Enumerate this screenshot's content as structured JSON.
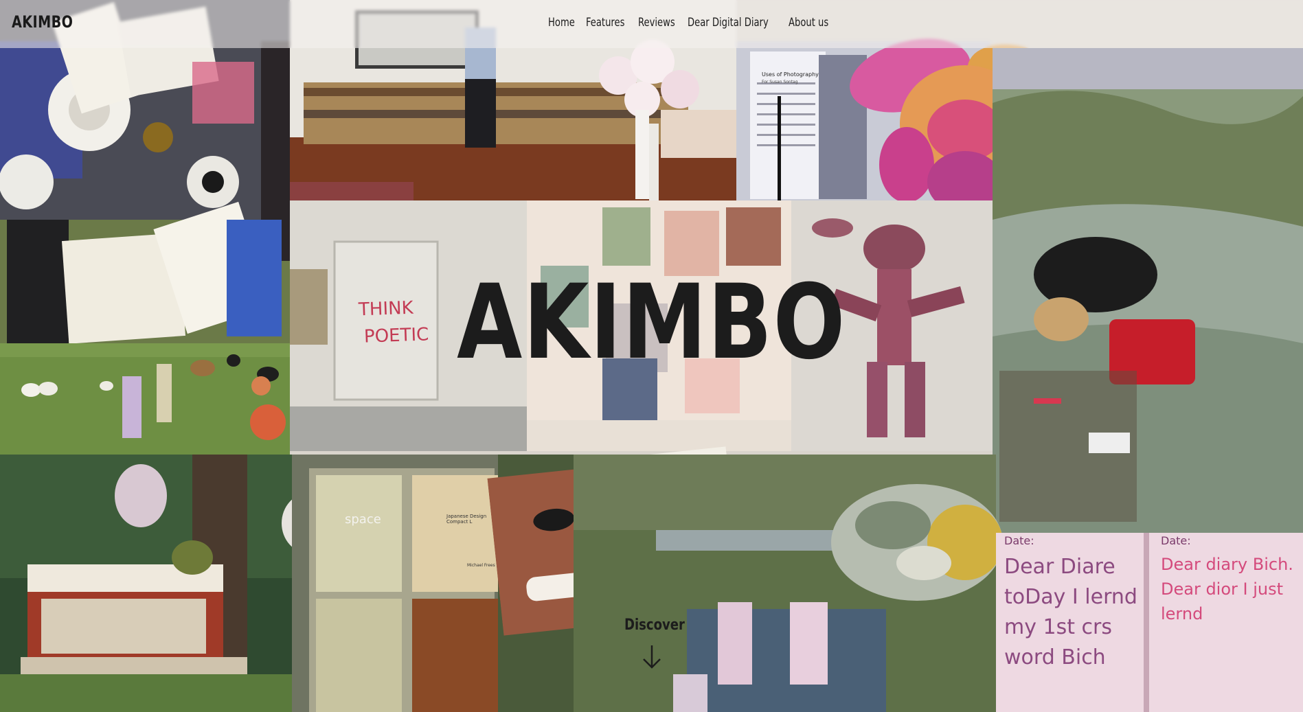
{
  "brand": "AKIMBO",
  "nav": {
    "items": [
      "Home",
      "Features",
      "Reviews",
      "Dear Digital Diary",
      "About us"
    ]
  },
  "hero": {
    "title": "AKIMBO",
    "discover_label": "Discover"
  },
  "collage": {
    "sign_text_line1": "THINK",
    "sign_text_line2": "POETIC",
    "book_word": "space",
    "book_subtitle": "Japanese Design Compact L",
    "book_author": "Michael Frees",
    "paper_title": "Uses of Photography",
    "paper_subtitle": "For Susan Sontag",
    "diary_left_date": "Date:",
    "diary_left_text": "Dear Diare toDay I lernd my 1st crs word Bich",
    "diary_right_date": "Date:",
    "diary_right_text": "Dear diary Bich. Dear dior I just lernd"
  },
  "colors": {
    "title_text": "#1c1c1c",
    "nav_background": "rgba(245,243,240,0.55)"
  }
}
